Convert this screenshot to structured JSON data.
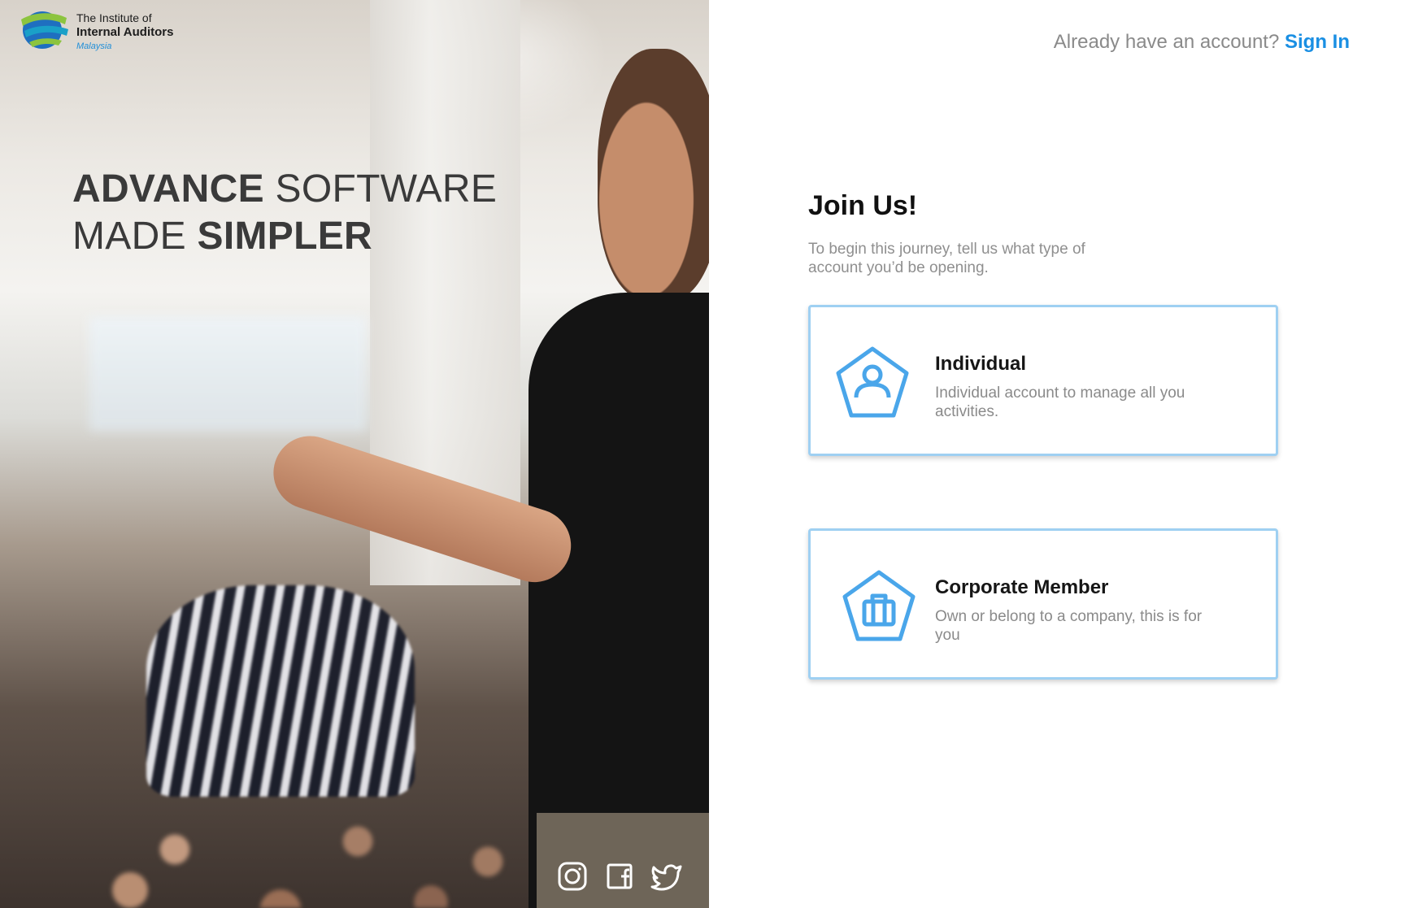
{
  "brand": {
    "line1": "The Institute of",
    "line2": "Internal Auditors",
    "line3": "Malaysia",
    "colors": {
      "green": "#8cc43f",
      "blue": "#1f6fc0",
      "teal": "#1aa0c8"
    }
  },
  "hero": {
    "headline_line1_bold": "ADVANCE",
    "headline_line1_light": "SOFTWARE",
    "headline_line2_light": "MADE",
    "headline_line2_bold": "SIMPLER"
  },
  "social": [
    {
      "icon": "instagram-icon"
    },
    {
      "icon": "facebook-icon"
    },
    {
      "icon": "twitter-icon"
    }
  ],
  "header": {
    "already_text": "Already have an account?",
    "sign_in_label": "Sign In"
  },
  "join": {
    "title": "Join Us!",
    "subtitle": "To begin this journey, tell us what type of account you’d be opening."
  },
  "account_types": [
    {
      "title": "Individual",
      "description": "Individual account to manage all you activities.",
      "icon": "user-icon"
    },
    {
      "title": "Corporate Member",
      "description": "Own or belong to a company, this is for you",
      "icon": "briefcase-icon"
    }
  ],
  "colors": {
    "accent": "#1a8fe3",
    "card_border": "#9fd0f2",
    "icon_blue": "#4aa6ea"
  }
}
